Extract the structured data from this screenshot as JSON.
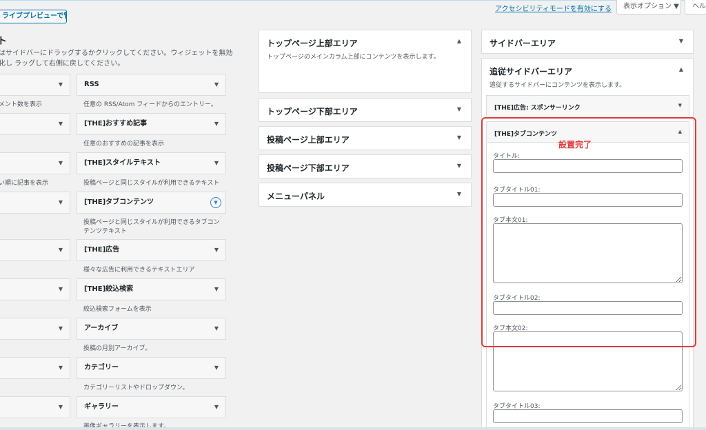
{
  "header": {
    "preview_button": "ライブプレビューで管理",
    "accessibility_link": "アクセシビリティモードを有効にする",
    "screen_options": "表示オプション ▼",
    "help": "ヘルプ"
  },
  "available": {
    "title": "ト",
    "description": "はサイドバーにドラッグするかクリックしてください。ウィジェットを無効化し ラッグして右側に戻してください。",
    "left_descs": [
      "メント数を表示",
      "",
      "い順に記事を表示"
    ],
    "widgets": [
      {
        "name": "RSS",
        "desc": "任意の RSS/Atom フィードからのエントリー。"
      },
      {
        "name": "[THE]おすすめ記事",
        "desc": "任意のおすすめの記事を表示"
      },
      {
        "name": "[THE]スタイルテキスト",
        "desc": "投稿ページと同じスタイルが利用できるテキスト"
      },
      {
        "name": "[THE]タブコンテンツ",
        "desc": "投稿ページと同じスタイルが利用できるタブコンテンツテキスト"
      },
      {
        "name": "[THE]広告",
        "desc": "様々な広告に利用できるテキストエリア"
      },
      {
        "name": "[THE]絞込検索",
        "desc": "絞込検索フォームを表示"
      },
      {
        "name": "アーカイブ",
        "desc": "投稿の月別アーカイブ。"
      },
      {
        "name": "カテゴリー",
        "desc": "カテゴリーリストやドロップダウン。"
      },
      {
        "name": "ギャラリー",
        "desc": "画像ギャラリーを表示します。"
      }
    ]
  },
  "middle_areas": [
    {
      "title": "トップページ上部エリア",
      "desc": "トップページのメインカラム上部にコンテンツを表示します。"
    },
    {
      "title": "トップページ下部エリア"
    },
    {
      "title": "投稿ページ上部エリア"
    },
    {
      "title": "投稿ページ下部エリア"
    },
    {
      "title": "メニューパネル"
    }
  ],
  "right_areas": {
    "sidebar": "サイドバーエリア",
    "follow_title": "追従サイドバーエリア",
    "follow_desc": "追従するサイドバーにコンテンツを表示します。",
    "ad_widget": "[THE]広告: スポンサーリンク",
    "tab_widget": "[THE]タブコンテンツ"
  },
  "form": {
    "title_label": "タイトル:",
    "tab_title_01": "タブタイトル01:",
    "tab_body_01": "タブ本文01:",
    "tab_title_02": "タブタイトル02:",
    "tab_body_02": "タブ本文02:",
    "tab_title_03": "タブタイトル03:"
  },
  "annotation": "設置完了",
  "icons": {
    "arrow_down": "▼",
    "arrow_up": "▲"
  }
}
